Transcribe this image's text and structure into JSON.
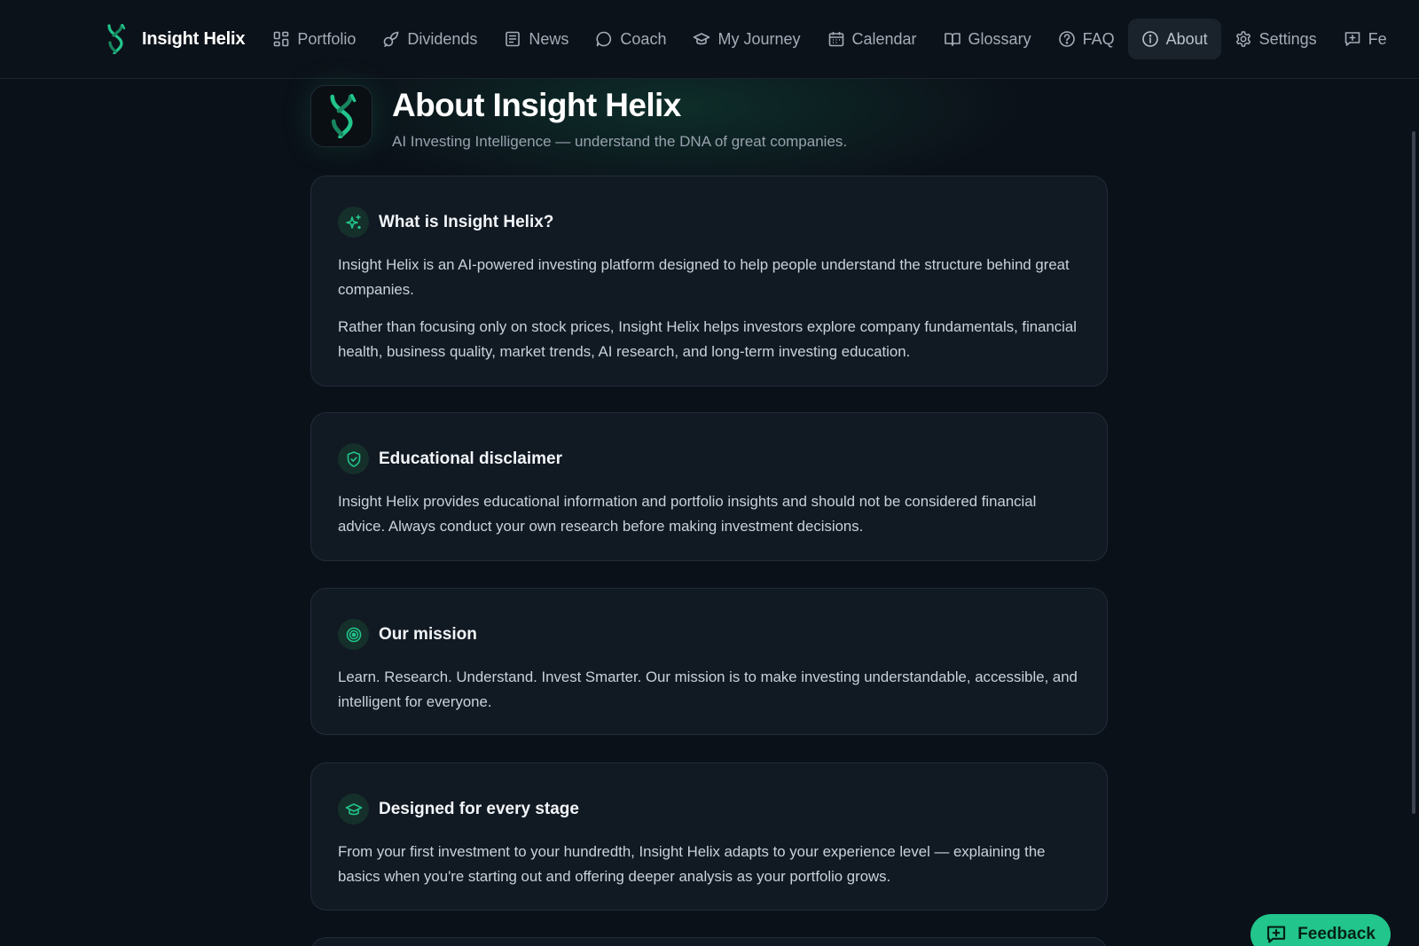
{
  "app": {
    "name": "Insight Helix"
  },
  "nav": {
    "items": [
      {
        "id": "portfolio",
        "label": "Portfolio",
        "icon": "grid-icon"
      },
      {
        "id": "dividends",
        "label": "Dividends",
        "icon": "sprout-icon"
      },
      {
        "id": "news",
        "label": "News",
        "icon": "newspaper-icon"
      },
      {
        "id": "coach",
        "label": "Coach",
        "icon": "chat-bubble-icon"
      },
      {
        "id": "my-journey",
        "label": "My Journey",
        "icon": "graduation-cap-icon"
      },
      {
        "id": "calendar",
        "label": "Calendar",
        "icon": "calendar-icon"
      },
      {
        "id": "glossary",
        "label": "Glossary",
        "icon": "book-open-icon"
      },
      {
        "id": "faq",
        "label": "FAQ",
        "icon": "help-circle-icon"
      },
      {
        "id": "about",
        "label": "About",
        "icon": "info-icon",
        "active": true
      },
      {
        "id": "settings",
        "label": "Settings",
        "icon": "gear-icon"
      },
      {
        "id": "feedback",
        "label": "Fe",
        "icon": "message-plus-icon"
      }
    ]
  },
  "page": {
    "title": "About Insight Helix",
    "subtitle": "AI Investing Intelligence — understand the DNA of great companies."
  },
  "cards": [
    {
      "title": "What is Insight Helix?",
      "icon": "sparkles-icon",
      "paragraphs": [
        "Insight Helix is an AI-powered investing platform designed to help people understand the structure behind great companies.",
        "Rather than focusing only on stock prices, Insight Helix helps investors explore company fundamentals, financial health, business quality, market trends, AI research, and long-term investing education."
      ]
    },
    {
      "title": "Educational disclaimer",
      "icon": "shield-check-icon",
      "paragraphs": [
        "Insight Helix provides educational information and portfolio insights and should not be considered financial advice. Always conduct your own research before making investment decisions."
      ]
    },
    {
      "title": "Our mission",
      "icon": "target-icon",
      "paragraphs": [
        "Learn. Research. Understand. Invest Smarter. Our mission is to make investing understandable, accessible, and intelligent for everyone."
      ]
    },
    {
      "title": "Designed for every stage",
      "icon": "graduation-cap-icon",
      "paragraphs": [
        "From your first investment to your hundredth, Insight Helix adapts to your experience level — explaining the basics when you're starting out and offering deeper analysis as your portfolio grows."
      ]
    }
  ],
  "feedback_button": {
    "label": "Feedback",
    "icon": "message-plus-icon"
  },
  "colors": {
    "accent": "#22c58b",
    "background": "#0b1119",
    "card": "#111923",
    "nav_active": "#1a222c"
  }
}
